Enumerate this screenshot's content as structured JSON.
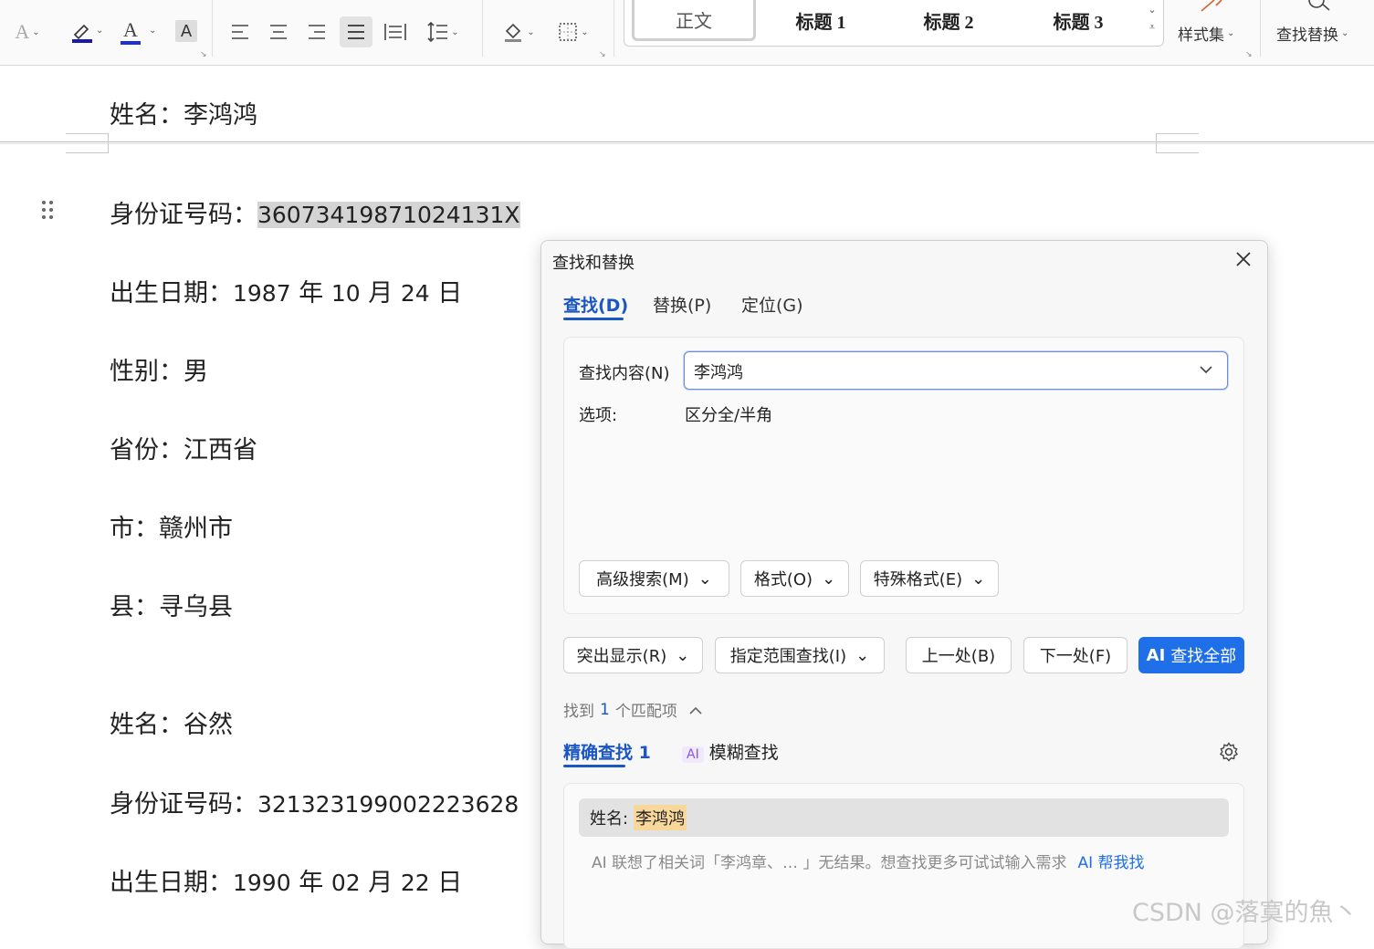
{
  "ribbon": {
    "styles": {
      "normal": "正文",
      "heading1": "标题 1",
      "heading2": "标题 2",
      "heading3": "标题 3"
    },
    "style_set_label": "样式集",
    "find_replace_label": "查找替换",
    "font_color_a": "A",
    "highlight_accent": "#1a1aa8",
    "font_color_accent": "#1f2fd8"
  },
  "document": {
    "lines": [
      {
        "prefix": "姓名：",
        "text": "李鸿鸿"
      },
      {
        "prefix": "身份证号码：",
        "text": "36073419871024131X"
      },
      {
        "prefix": "出生日期：",
        "text": "",
        "birth": {
          "y": "1987",
          "m": "10",
          "d": "24"
        }
      },
      {
        "prefix": "性别：",
        "text": "男"
      },
      {
        "prefix": "省份：",
        "text": "江西省"
      },
      {
        "prefix": "市：",
        "text": "赣州市"
      },
      {
        "prefix": "县：",
        "text": "寻乌县"
      },
      {
        "prefix": "姓名：",
        "text": "谷然"
      },
      {
        "prefix": "身份证号码：",
        "text": "321323199002223628"
      },
      {
        "prefix": "出生日期：",
        "text": "",
        "birth": {
          "y": "1990",
          "m": "02",
          "d": "22"
        }
      }
    ],
    "units": {
      "year": "年",
      "month": "月",
      "day": "日"
    }
  },
  "dialog": {
    "title": "查找和替换",
    "tabs": [
      "查找(D)",
      "替换(P)",
      "定位(G)"
    ],
    "find_label": "查找内容(N)",
    "find_value": "李鸿鸿",
    "options_label": "选项:",
    "options_value": "区分全/半角",
    "buttons": {
      "advanced": "高级搜索(M)",
      "format": "格式(O)",
      "special": "特殊格式(E)",
      "highlight": "突出显示(R)",
      "scope": "指定范围查找(I)",
      "prev": "上一处(B)",
      "next": "下一处(F)",
      "find_all_ai": "AI",
      "find_all": "查找全部"
    },
    "found": {
      "before": "找到",
      "count": "1",
      "after": "个匹配项"
    },
    "subtabs": {
      "exact": "精确查找 1",
      "fuzzy_badge": "AI",
      "fuzzy": "模糊查找"
    },
    "result": {
      "prefix": "姓名:",
      "match": "李鸿鸿"
    },
    "ai_hint": "AI 联想了相关词「李鸿章、…    」无结果。想查找更多可试试输入需求",
    "ai_link": "AI 帮我找",
    "accent": "#1e6fe8"
  },
  "watermark": "CSDN @落寞的魚丶"
}
